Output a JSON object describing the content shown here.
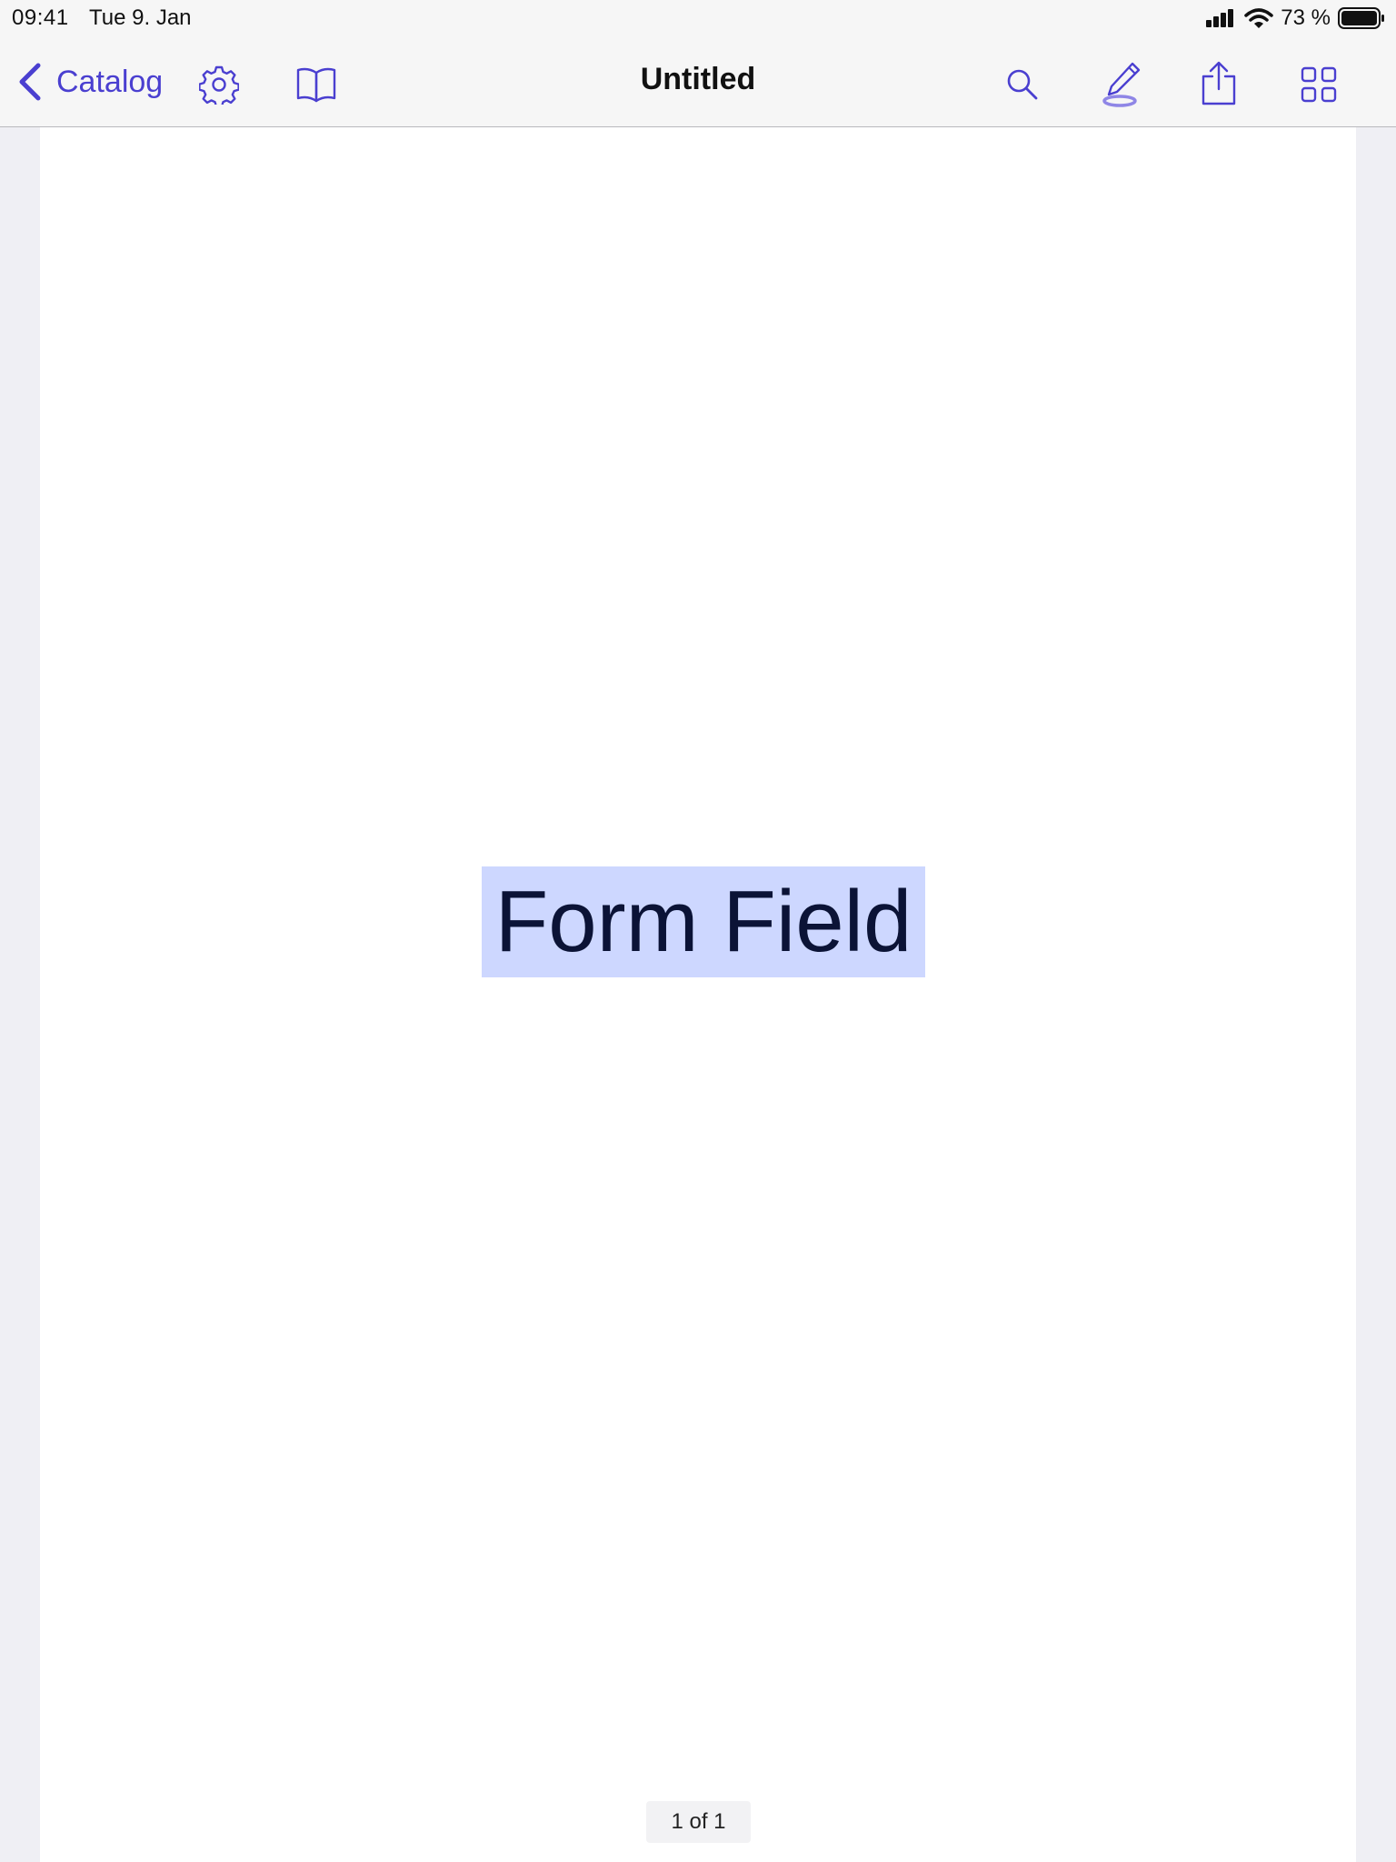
{
  "status_bar": {
    "time": "09:41",
    "date": "Tue 9. Jan",
    "battery_percent": "73 %"
  },
  "nav_bar": {
    "back_label": "Catalog",
    "title": "Untitled",
    "icons": [
      "chevron-left-icon",
      "gear-icon",
      "book-icon",
      "search-icon",
      "pen-icon",
      "share-icon",
      "grid-icon"
    ]
  },
  "document": {
    "form_field_text": "Form Field"
  },
  "page_indicator": "1 of 1",
  "colors": {
    "accent": "#4a3fd0",
    "form_field_highlight": "#cdd7ff",
    "form_field_text": "#0b1336",
    "background": "#efeff4",
    "page": "#ffffff"
  }
}
